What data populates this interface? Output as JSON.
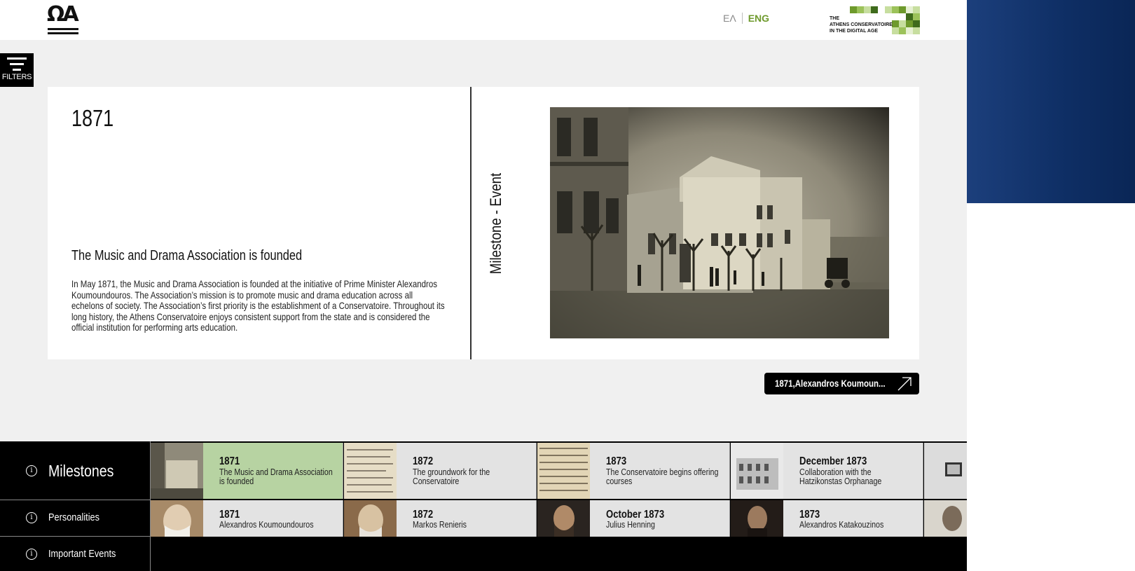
{
  "header": {
    "logo_text": "ΩΑ",
    "lang_el": "ΕΛ",
    "lang_en": "ENG",
    "brand_lines": [
      "THE",
      "ATHENS CONSERVATOIRE",
      "IN THE DIGITAL AGE"
    ]
  },
  "filters": {
    "label": "FILTERS"
  },
  "card": {
    "year": "1871",
    "title": "The Music and Drama Association is founded",
    "body": "In May 1871, the Music and Drama Association is founded at the initiative of Prime Minister Alexandros Koumoundouros. The Association’s mission is to promote music and drama education across all echelons of society. The Association’s first priority is the establishment of a Conservatoire. Throughout its long history, the Athens Conservatoire enjoys consistent support from the state and is considered the official institution for performing arts education.",
    "category": "Milestone - Event"
  },
  "related_link": {
    "label": "1871,Alexandros Koumoun..."
  },
  "categories": [
    {
      "label": "Milestones"
    },
    {
      "label": "Personalities"
    },
    {
      "label": "Important Events"
    }
  ],
  "milestones": [
    {
      "year": "1871",
      "desc": "The Music and Drama Association is founded",
      "active": true
    },
    {
      "year": "1872",
      "desc": "The groundwork for the Conservatoire"
    },
    {
      "year": "1873",
      "desc": "The Conservatoire begins offering courses"
    },
    {
      "year": "December 1873",
      "desc": "Collaboration with the Hatzikonstas Orphanage"
    }
  ],
  "personalities": [
    {
      "year": "1871",
      "desc": "Alexandros Koumoundouros"
    },
    {
      "year": "1872",
      "desc": "Markos Renieris"
    },
    {
      "year": "October 1873",
      "desc": "Julius Henning"
    },
    {
      "year": "1873",
      "desc": "Alexandros Katakouzinos"
    }
  ],
  "colors": {
    "accent_green": "#6e9a2c",
    "active_item": "#b7d3a2",
    "panel_blue": "#0e2e64"
  },
  "icons": {
    "info": "info-icon",
    "filter": "filter-icon",
    "arrow": "arrow-up-right-icon"
  }
}
